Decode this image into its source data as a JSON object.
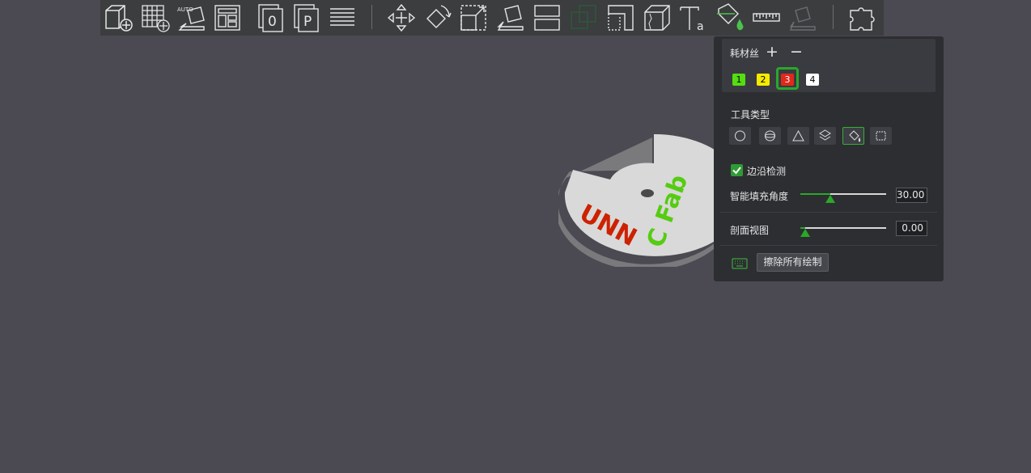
{
  "toolbar": {
    "tools": [
      {
        "name": "add-object-icon"
      },
      {
        "name": "add-plate-icon"
      },
      {
        "name": "auto-orient-icon",
        "text": "AUTO"
      },
      {
        "name": "arrange-icon"
      },
      {
        "name": "slice-plate-0-icon",
        "text": "0"
      },
      {
        "name": "slice-plate-p-icon",
        "text": "P"
      },
      {
        "name": "layers-icon"
      },
      {
        "name": "move-icon"
      },
      {
        "name": "rotate-icon"
      },
      {
        "name": "scale-icon"
      },
      {
        "name": "lay-on-face-icon"
      },
      {
        "name": "split-icon"
      },
      {
        "name": "boolean-icon"
      },
      {
        "name": "cut-icon"
      },
      {
        "name": "support-paint-icon"
      },
      {
        "name": "text-tool-icon",
        "text": "a"
      },
      {
        "name": "color-paint-icon"
      },
      {
        "name": "measure-icon"
      },
      {
        "name": "assembly-icon"
      },
      {
        "name": "plugin-puzzle-icon"
      }
    ]
  },
  "panel": {
    "filament_title": "耗材丝",
    "add_label": "+",
    "remove_label": "−",
    "swatches": [
      {
        "label": "1",
        "color": "#55dd11",
        "text_color": "#000000"
      },
      {
        "label": "2",
        "color": "#f5ea00",
        "text_color": "#000000"
      },
      {
        "label": "3",
        "color": "#e0291b",
        "text_color": "#ffffff"
      },
      {
        "label": "4",
        "color": "#ffffff",
        "text_color": "#000000"
      }
    ],
    "selected_swatch": "3",
    "tool_type_label": "工具类型",
    "tool_types": [
      "circle-brush-icon",
      "sphere-brush-icon",
      "triangle-brush-icon",
      "height-range-icon",
      "fill-bucket-icon",
      "gap-fill-icon"
    ],
    "selected_tool": "fill-bucket-icon",
    "edge_detect_label": "边沿检测",
    "edge_detect_checked": true,
    "smart_fill_label": "智能填充角度",
    "smart_fill_value": "30.00",
    "smart_fill_fraction": 0.35,
    "section_view_label": "剖面视图",
    "section_view_value": "0.00",
    "section_view_fraction": 0.06,
    "erase_label": "擦除所有绘制"
  },
  "model": {
    "text_red": "UNN",
    "text_green": "C Fab",
    "disc_color": "#d9d9d9",
    "red": "#cc2200",
    "green": "#55cc11"
  },
  "colors": {
    "background": "#4b4a52",
    "toolbar": "#3b3d3f",
    "panel": "#2d2e32",
    "accent": "#2aa82a"
  }
}
